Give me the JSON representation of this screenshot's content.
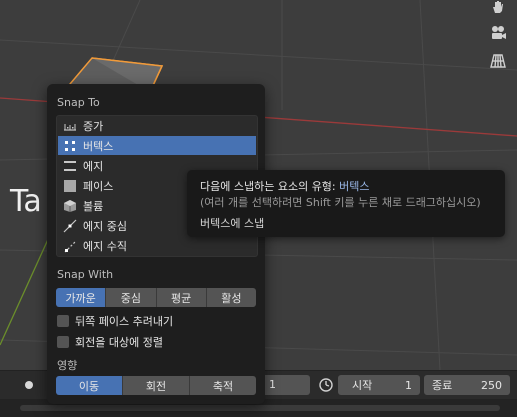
{
  "viewport": {
    "overlay_text": "Ta",
    "colors": {
      "x_axis": "#9b3a3a",
      "y_axis": "#6b8e2b",
      "selection": "#f09a3a"
    }
  },
  "nav_icons": [
    "hand-icon",
    "camera-icon",
    "grid-icon"
  ],
  "popover": {
    "snap_to_title": "Snap To",
    "snap_targets": [
      {
        "label": "증가",
        "icon": "increment-icon",
        "active": false
      },
      {
        "label": "버텍스",
        "icon": "vertex-icon",
        "active": true
      },
      {
        "label": "에지",
        "icon": "edge-icon",
        "active": false
      },
      {
        "label": "페이스",
        "icon": "face-icon",
        "active": false
      },
      {
        "label": "볼륨",
        "icon": "volume-icon",
        "active": false
      },
      {
        "label": "에지 중심",
        "icon": "edge-center-icon",
        "active": false
      },
      {
        "label": "에지 수직",
        "icon": "edge-perpendicular-icon",
        "active": false
      }
    ],
    "snap_with_title": "Snap With",
    "snap_with_options": [
      "가까운",
      "중심",
      "평균",
      "활성"
    ],
    "snap_with_selected": "가까운",
    "checkboxes": [
      {
        "label": "뒤쪽 페이스 추려내기",
        "checked": false
      },
      {
        "label": "회전을 대상에 정렬",
        "checked": false
      }
    ],
    "affect_title": "영향",
    "affect_options": [
      "이동",
      "회전",
      "축적"
    ],
    "affect_selected": "이동"
  },
  "tooltip": {
    "line1_prefix": "다음에 스냅하는 요소의 유형:",
    "line1_value": "버텍스",
    "line2": "(여러 개를 선택하려면 Shift 키를 누른 채로 드래그하십시오)",
    "line3": "버텍스에 스냅"
  },
  "timeline": {
    "current_frame": "1",
    "start_label": "시작",
    "start_value": "1",
    "end_label": "종료",
    "end_value": "250"
  }
}
